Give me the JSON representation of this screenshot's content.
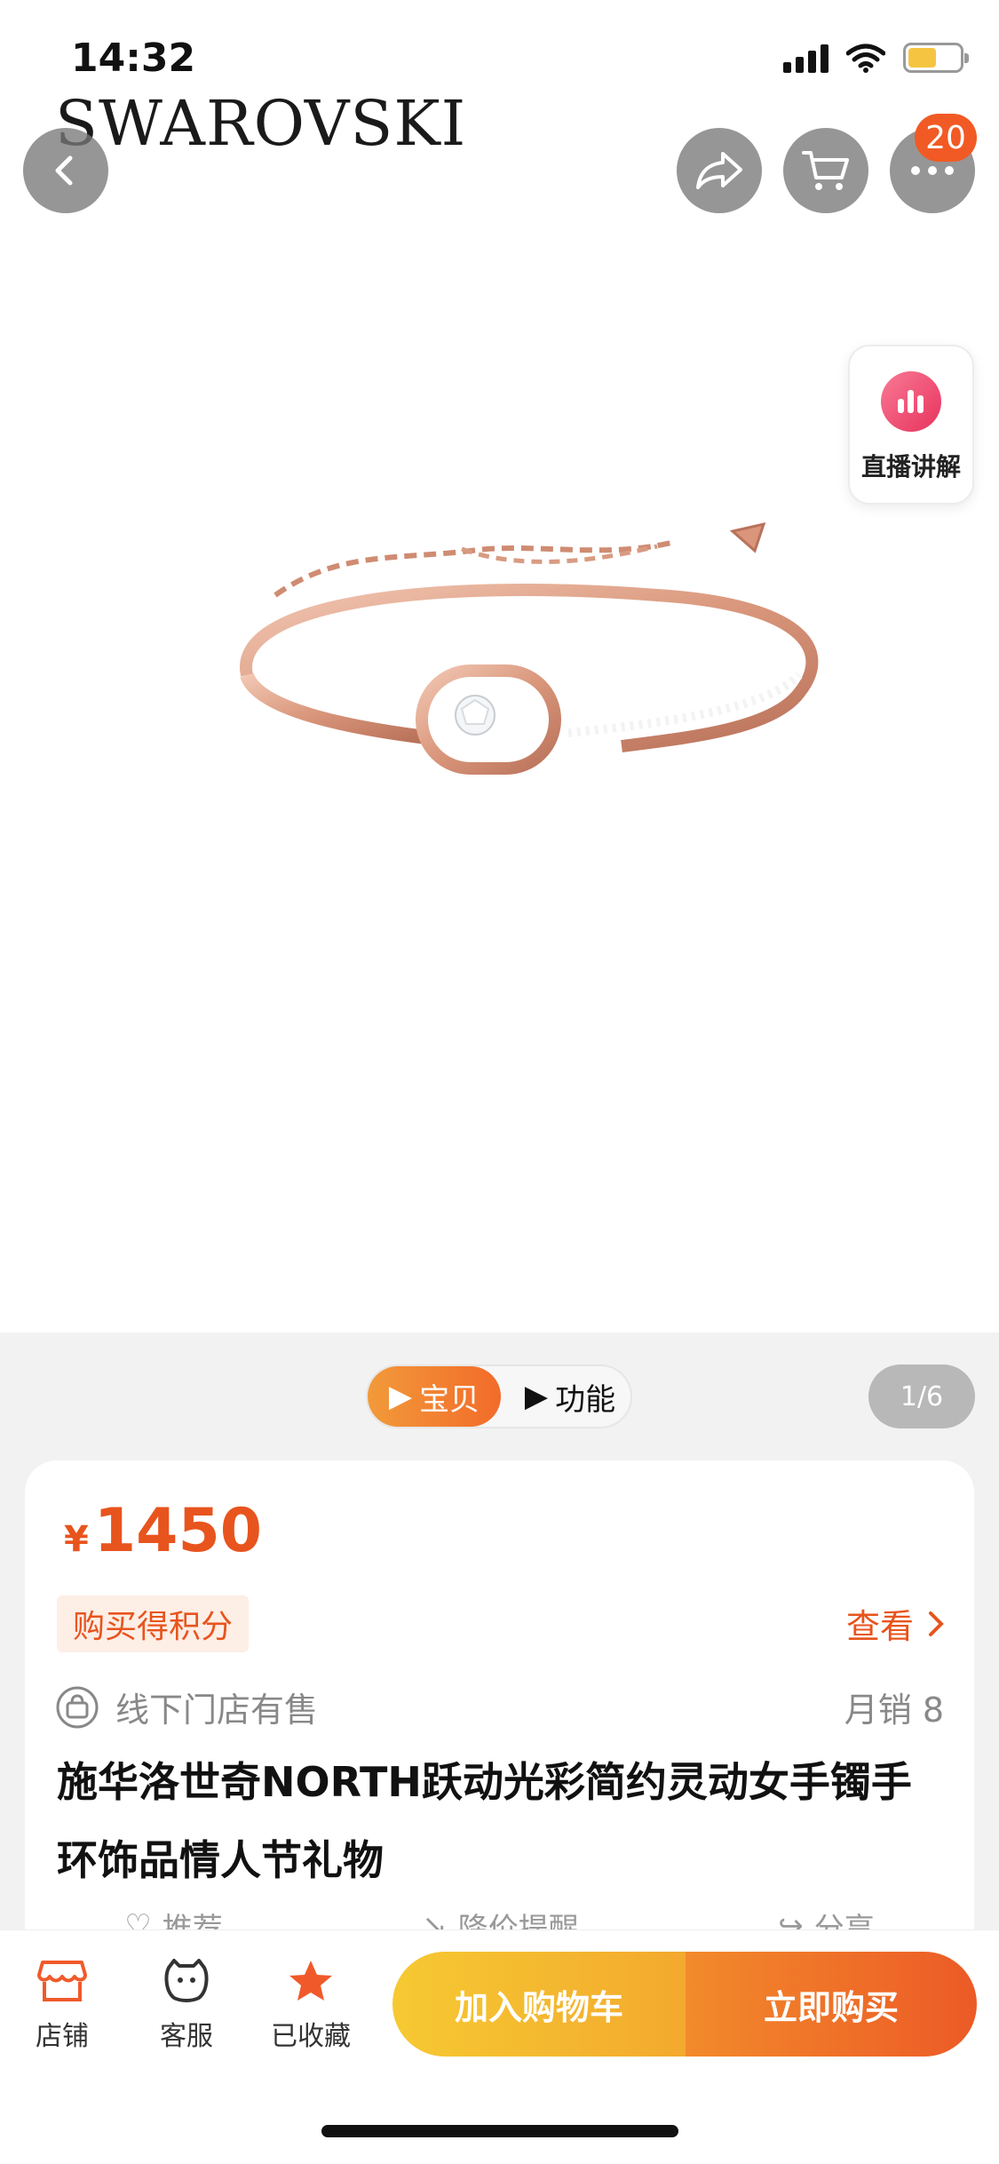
{
  "status_bar": {
    "time": "14:32"
  },
  "brand": "SWAROVSKI",
  "header": {
    "cart_badge": "20"
  },
  "live": {
    "label": "直播讲解"
  },
  "gallery": {
    "tabs": [
      {
        "label": "宝贝",
        "active": true
      },
      {
        "label": "功能",
        "active": false
      }
    ],
    "counter": "1/6"
  },
  "product": {
    "currency": "¥",
    "price": "1450",
    "points_tag": "购买得积分",
    "view_link": "查看",
    "offline_text": "线下门店有售",
    "monthly_sales": "月销 8",
    "title": "施华洛世奇NORTH跃动光彩简约灵动女手镯手环饰品情人节礼物",
    "actions": [
      "推荐",
      "降价提醒",
      "分享"
    ]
  },
  "bottom_bar": {
    "nav": [
      {
        "label": "店铺"
      },
      {
        "label": "客服"
      },
      {
        "label": "已收藏"
      }
    ],
    "add_to_cart": "加入购物车",
    "buy_now": "立即购买"
  },
  "colors": {
    "accent": "#e8541d",
    "buy_gradient_end": "#ec5a26",
    "cart_gradient_start": "#f6c932"
  }
}
